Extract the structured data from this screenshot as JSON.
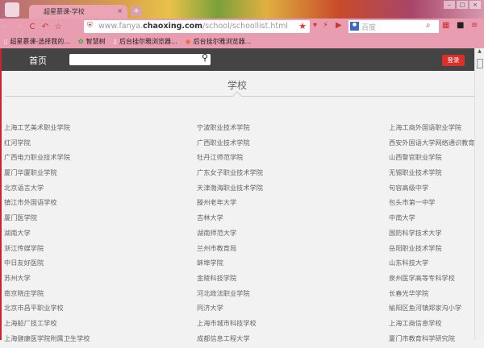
{
  "browser": {
    "tab_title": "超星慕课-学校",
    "url_prefix": "www.fanya.",
    "url_domain": "chaoxing.com",
    "url_path": "/school/schoollist.html",
    "search_placeholder": "百度",
    "bookmarks": [
      "超星慕课-选择我的...",
      "智慧树",
      "后台挂尔雅浏览器...",
      "后台挂尔雅浏览器..."
    ]
  },
  "nav": {
    "home": "首页",
    "search_value": "",
    "login": "登录"
  },
  "page": {
    "title": "学校"
  },
  "schools": [
    [
      "上海工艺美术职业学院",
      "宁波职业技术学院",
      "上海工商外国语职业学院"
    ],
    [
      "红河学院",
      "广西职业技术学院",
      "西安外国语大学网络通识教育"
    ],
    [
      "广西电力职业技术学院",
      "牡丹江师范学院",
      "山西警官职业学院"
    ],
    [
      "厦门华厦职业学院",
      "广东女子职业技术学院",
      "无锡职业技术学院"
    ],
    [
      "北京语言大学",
      "天津渤海职业技术学院",
      "句容高级中学"
    ],
    [
      "镇江市外国语学校",
      "滕州老年大学",
      "包头市第一中学"
    ],
    [
      "厦门医学院",
      "吉林大学",
      "中南大学"
    ],
    [
      "湖南大学",
      "湖南师范大学",
      "国防科学技术大学"
    ],
    [
      "浙江传媒学院",
      "兰州市教育局",
      "岳阳职业技术学院"
    ],
    [
      "中日友好医院",
      "蚌埠学院",
      "山东科技大学"
    ],
    [
      "苏州大学",
      "金陵科技学院",
      "泉州医学高等专科学校"
    ],
    [
      "南京晓庄学院",
      "河北政法职业学院",
      "长春光华学院"
    ],
    [
      "北京市昌平职业学校",
      "同济大学",
      "榆阳区鱼河镇郑家沟小学"
    ],
    [
      "上海船厂技工学校",
      "上海市城市科技学校",
      "上海工商信息学校"
    ],
    [
      "上海健康医学院附属卫生学校",
      "成都信息工程大学",
      "厦门市教育科学研究院"
    ]
  ]
}
